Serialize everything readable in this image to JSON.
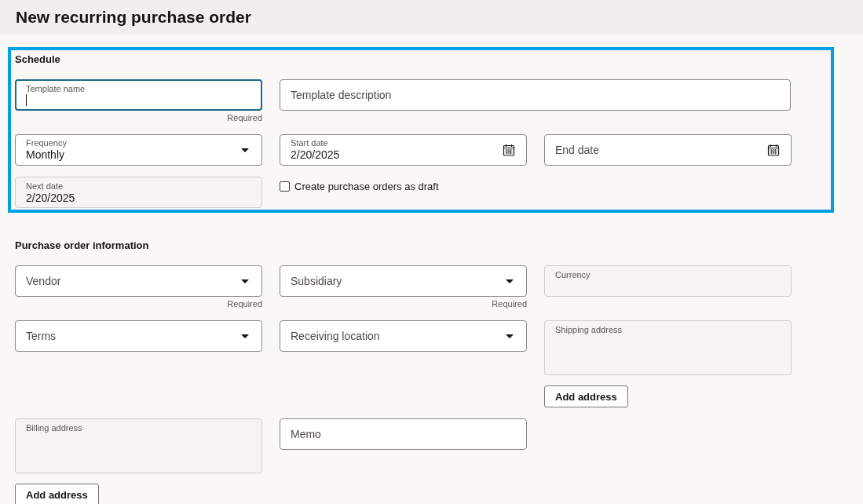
{
  "page": {
    "title": "New recurring purchase order"
  },
  "sections": [
    {
      "title": "Schedule",
      "highlighted": true,
      "rows": [
        [
          {
            "kind": "text",
            "label": "Template name",
            "focused": true,
            "hint": "Required"
          },
          {
            "kind": "wide_text",
            "label": "Template description"
          }
        ],
        [
          {
            "kind": "select",
            "label": "Frequency",
            "value": "Monthly"
          },
          {
            "kind": "date",
            "label": "Start date",
            "value": "2/20/2025"
          },
          {
            "kind": "date",
            "label": "End date"
          }
        ],
        [
          {
            "kind": "readonly",
            "label": "Next date",
            "value": "2/20/2025"
          },
          {
            "kind": "checkbox",
            "label": "Create purchase orders as draft",
            "checked": false
          }
        ]
      ]
    },
    {
      "title": "Purchase order information",
      "highlighted": false,
      "rows": [
        [
          {
            "kind": "select",
            "label": "Vendor",
            "hint": "Required"
          },
          {
            "kind": "select",
            "label": "Subsidiary",
            "hint": "Required"
          },
          {
            "kind": "readonly",
            "label": "Currency"
          }
        ],
        [
          {
            "kind": "select",
            "label": "Terms"
          },
          {
            "kind": "select",
            "label": "Receiving location"
          },
          {
            "kind": "address",
            "label": "Shipping address",
            "button": "Add address"
          }
        ],
        [
          {
            "kind": "address",
            "label": "Billing address",
            "button": "Add address"
          },
          {
            "kind": "text",
            "label": "Memo",
            "focused": false
          }
        ]
      ]
    }
  ]
}
